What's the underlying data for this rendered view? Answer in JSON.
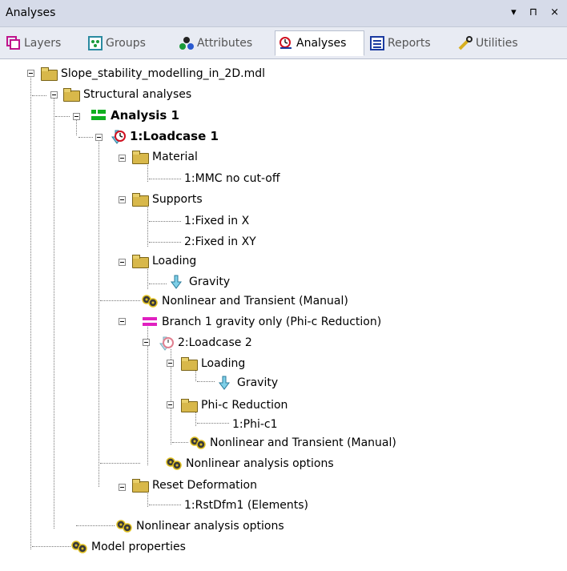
{
  "panel": {
    "title": "Analyses",
    "controls": "▾ ⊓ ×"
  },
  "tabs": [
    {
      "label": "Layers",
      "icon": "layers-icon"
    },
    {
      "label": "Groups",
      "icon": "groups-icon"
    },
    {
      "label": "Attributes",
      "icon": "attributes-icon"
    },
    {
      "label": "Analyses",
      "icon": "analyses-icon",
      "active": true
    },
    {
      "label": "Reports",
      "icon": "reports-icon"
    },
    {
      "label": "Utilities",
      "icon": "utilities-icon"
    }
  ],
  "tree": {
    "model": "Slope_stability_modelling_in_2D.mdl",
    "structural": "Structural analyses",
    "analysis": "Analysis 1",
    "loadcase1": "1:Loadcase 1",
    "material": "Material",
    "material_item": "1:MMC no cut-off",
    "supports": "Supports",
    "support1": "1:Fixed in X",
    "support2": "2:Fixed in XY",
    "loading": "Loading",
    "gravity": "Gravity",
    "nonlinear_manual": "Nonlinear and Transient (Manual)",
    "branch": "Branch 1 gravity only (Phi-c Reduction)",
    "loadcase2": "2:Loadcase 2",
    "loading2": "Loading",
    "gravity2": "Gravity",
    "phic": "Phi-c Reduction",
    "phic_item": "1:Phi-c1",
    "nonlinear_manual2": "Nonlinear and Transient (Manual)",
    "nonlinear_opts_branch": "Nonlinear analysis options",
    "reset": "Reset Deformation",
    "reset_item": "1:RstDfm1 (Elements)",
    "nonlinear_opts": "Nonlinear analysis options",
    "model_props": "Model properties"
  },
  "colors": {
    "gear": "#2a2a2a",
    "arrow": "#7fd0e8",
    "branch": "#e020c0",
    "analysis": "#10b020"
  }
}
